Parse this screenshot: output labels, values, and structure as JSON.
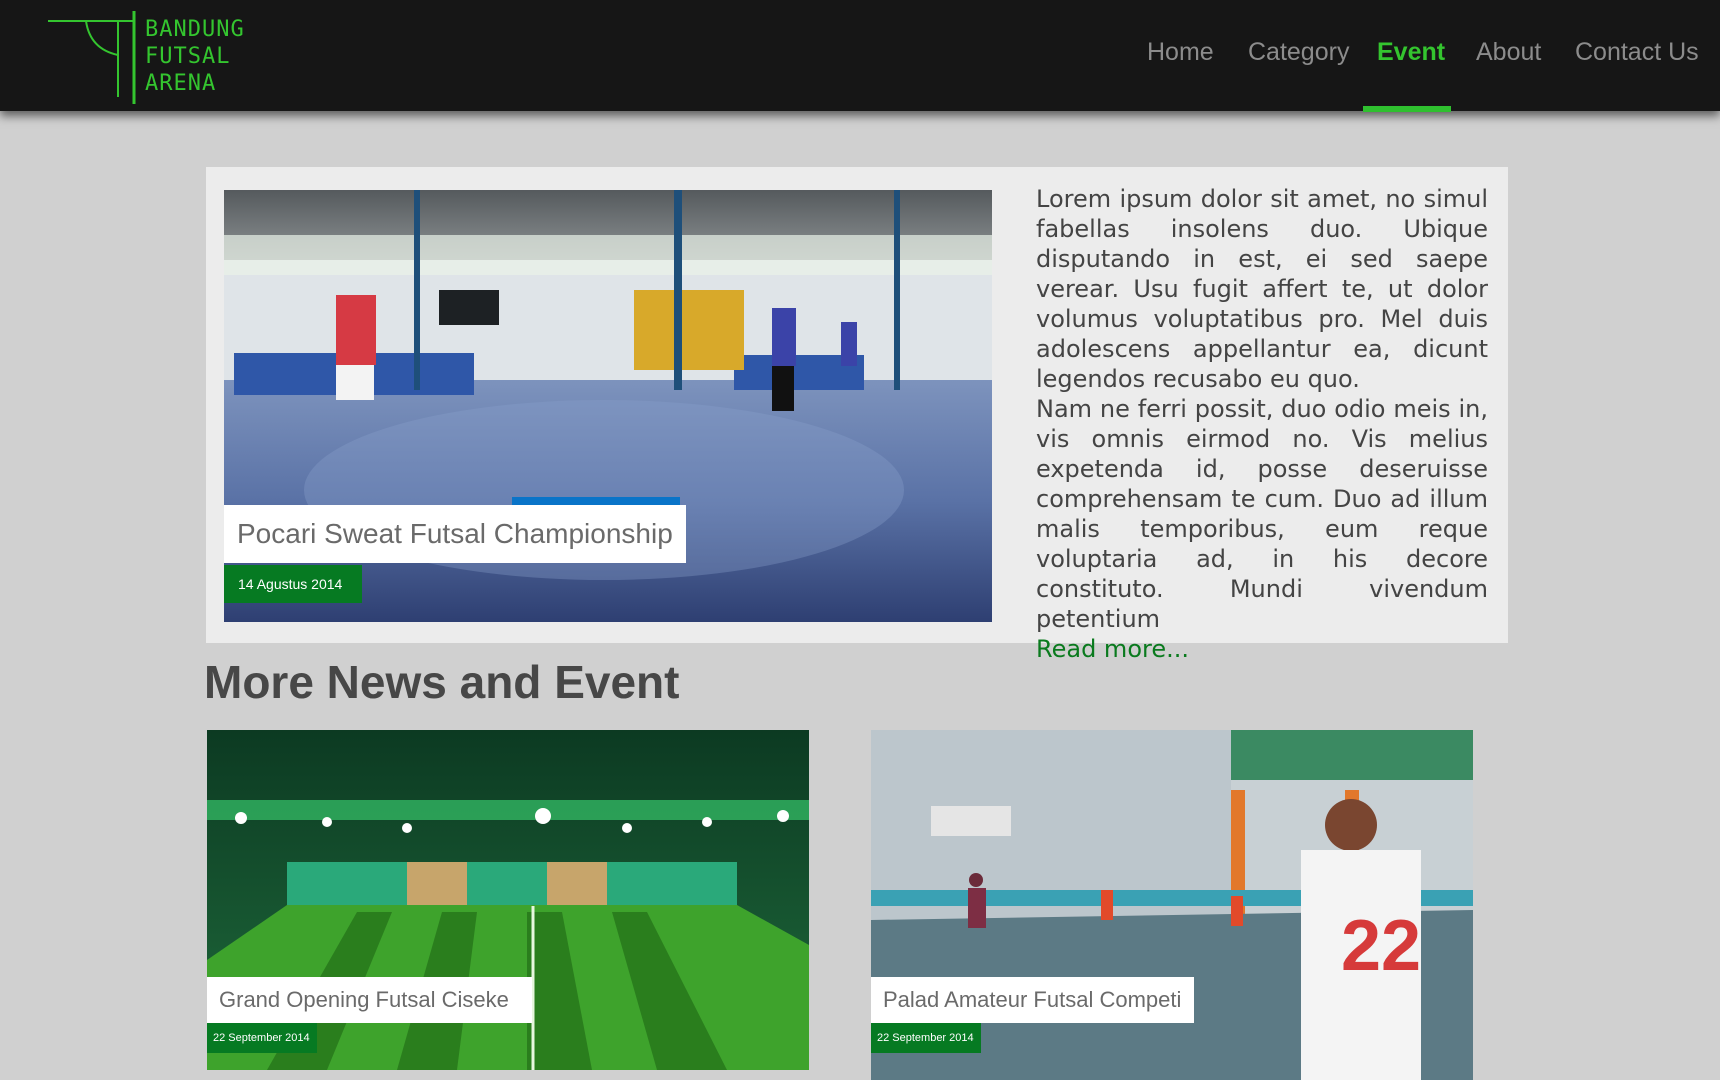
{
  "brand": {
    "line1": "BANDUNG",
    "line2": "FUTSAL",
    "line3": "ARENA",
    "accent": "#34c52f"
  },
  "nav": {
    "items": [
      {
        "label": "Home"
      },
      {
        "label": "Category"
      },
      {
        "label": "Event",
        "active": true
      },
      {
        "label": "About"
      },
      {
        "label": "Contact Us"
      }
    ]
  },
  "featured": {
    "title": "Pocari Sweat Futsal Championship",
    "date": "14 Agustus 2014",
    "image_icon": "futsal-indoor-court-photo",
    "paragraph1": "Lorem ipsum dolor sit amet, no simul fabellas insolens duo. Ubique disputando in est, ei sed saepe verear. Usu fugit affert te, ut dolor volumus voluptatibus pro. Mel duis adolescens appellantur ea, dicunt legendos recusabo eu quo.",
    "paragraph2": "Nam ne ferri possit, duo odio meis in, vis omnis eirmod no. Vis melius expetenda id, posse deseruisse comprehensam te cum. Duo ad illum malis temporibus, eum reque voluptaria ad, in his decore constituto. Mundi vivendum petentium",
    "read_more": "Read more..."
  },
  "more": {
    "title": "More News and Event",
    "cards": [
      {
        "title": "Grand Opening Futsal Ciseke",
        "date": "22 September 2014"
      },
      {
        "title": "Palad Amateur Futsal Competi",
        "date": "22 September 2014"
      }
    ]
  }
}
